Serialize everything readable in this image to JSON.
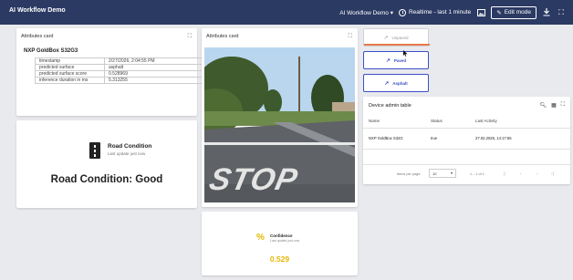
{
  "app": {
    "title": "AI Workflow Demo"
  },
  "toolbar": {
    "workflow_selector": "AI Workflow Demo ▾",
    "time_range": "Realtime - last 1 minute",
    "edit_mode": "Edit mode"
  },
  "attributes_card": {
    "title": "Attributes card",
    "device": "NXP GoldBox S32G3",
    "rows": [
      {
        "key": "timestamp",
        "value": "2/27/2026, 2:04:55 PM"
      },
      {
        "key": "predicted surface",
        "value": "asphalt"
      },
      {
        "key": "predicted surface score",
        "value": "0.528969"
      },
      {
        "key": "inference duration in ms",
        "value": "5.313255"
      }
    ]
  },
  "road_condition": {
    "heading": "Road Condition",
    "subtitle": "Last update just now",
    "value": "Road Condition: Good"
  },
  "image_card": {
    "title": "Attributes card",
    "road_text": "STOP"
  },
  "confidence": {
    "label": "Confidence",
    "subtitle": "Last update just now",
    "value": "0.529",
    "accent": "#e6b800"
  },
  "actions": [
    {
      "label": "Unpaved"
    },
    {
      "label": "Paved"
    },
    {
      "label": "Asphalt"
    }
  ],
  "admin_table": {
    "title": "Device admin table",
    "columns": [
      "Name",
      "Status",
      "Last Activity"
    ],
    "rows": [
      {
        "name": "NXP GoldBox S32G",
        "status": "true",
        "last_activity": "27.02.2026, 14:17:55"
      }
    ],
    "items_per_page_label": "Items per page:",
    "items_per_page": "10",
    "range": "1 – 1 of 1"
  },
  "colors": {
    "topbar": "#2b3a63",
    "primary": "#3b4fc9",
    "accent_orange": "#e87a4a"
  }
}
